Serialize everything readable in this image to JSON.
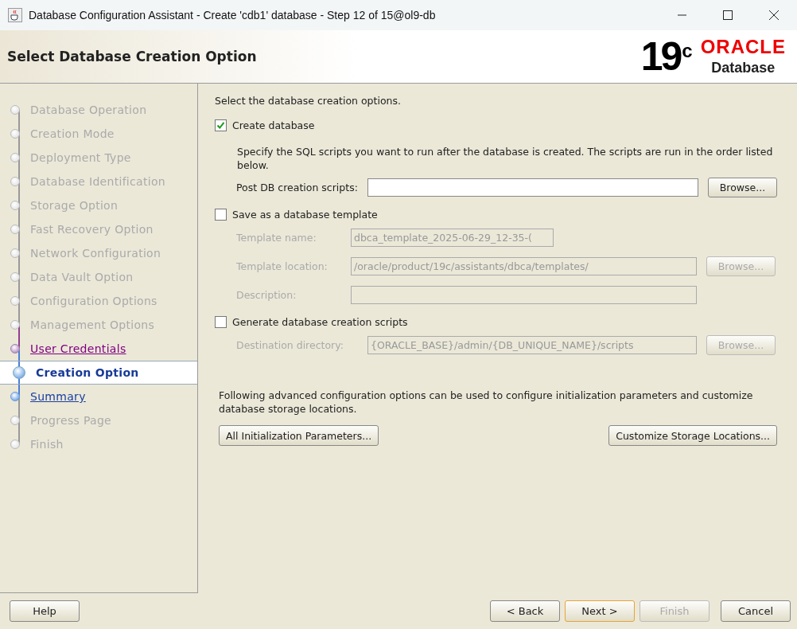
{
  "window": {
    "title": "Database Configuration Assistant - Create 'cdb1' database - Step 12 of 15@ol9-db"
  },
  "header": {
    "title": "Select Database Creation Option",
    "logo_version": "19",
    "logo_suffix": "c",
    "logo_brand": "ORACLE",
    "logo_product": "Database"
  },
  "steps": [
    {
      "label": "Database Operation",
      "kind": "disabled",
      "selected": false
    },
    {
      "label": "Creation Mode",
      "kind": "disabled",
      "selected": false
    },
    {
      "label": "Deployment Type",
      "kind": "disabled",
      "selected": false
    },
    {
      "label": "Database Identification",
      "kind": "disabled",
      "selected": false
    },
    {
      "label": "Storage Option",
      "kind": "disabled",
      "selected": false
    },
    {
      "label": "Fast Recovery Option",
      "kind": "disabled",
      "selected": false
    },
    {
      "label": "Network Configuration",
      "kind": "disabled",
      "selected": false
    },
    {
      "label": "Data Vault Option",
      "kind": "disabled",
      "selected": false
    },
    {
      "label": "Configuration Options",
      "kind": "disabled",
      "selected": false
    },
    {
      "label": "Management Options",
      "kind": "disabled",
      "selected": false
    },
    {
      "label": "User Credentials",
      "kind": "visited",
      "selected": false
    },
    {
      "label": "Creation Option",
      "kind": "current",
      "selected": true
    },
    {
      "label": "Summary",
      "kind": "link",
      "selected": false
    },
    {
      "label": "Progress Page",
      "kind": "disabled",
      "selected": false
    },
    {
      "label": "Finish",
      "kind": "disabled",
      "selected": false
    }
  ],
  "content": {
    "intro": "Select the database creation options.",
    "create_database": {
      "label": "Create database",
      "checked": true,
      "description": "Specify the SQL scripts you want to run after the database is created. The scripts are run in the order listed below.",
      "scripts_label": "Post DB creation scripts:",
      "browse": "Browse..."
    },
    "save_template": {
      "label": "Save as a database template",
      "checked": false,
      "fields": [
        {
          "label": "Template name:",
          "value": "dbca_template_2025-06-29_12-35-(",
          "disabled": true,
          "kind": "short"
        },
        {
          "label": "Template location:",
          "value": "/oracle/product/19c/assistants/dbca/templates/",
          "disabled": true,
          "kind": "browse",
          "browse": "Browse..."
        },
        {
          "label": "Description:",
          "disabled": true,
          "kind": "plain"
        }
      ]
    },
    "generate_scripts": {
      "label": "Generate database creation scripts",
      "checked": false,
      "field": {
        "label": "Destination directory:",
        "value": "{ORACLE_BASE}/admin/{DB_UNIQUE_NAME}/scripts",
        "disabled": true,
        "browse": "Browse..."
      }
    },
    "advanced_text": "Following advanced configuration options can be used to configure initialization parameters and customize database storage locations.",
    "advanced_buttons": [
      "All Initialization Parameters...",
      "Customize Storage Locations..."
    ]
  },
  "footer": {
    "help": "Help",
    "buttons": [
      {
        "label": "< Back",
        "disabled": false,
        "focused": false
      },
      {
        "label": "Next >",
        "disabled": false,
        "focused": true
      },
      {
        "label": "Finish",
        "disabled": true,
        "focused": false
      },
      {
        "label": "Cancel",
        "disabled": false,
        "focused": false
      }
    ]
  }
}
